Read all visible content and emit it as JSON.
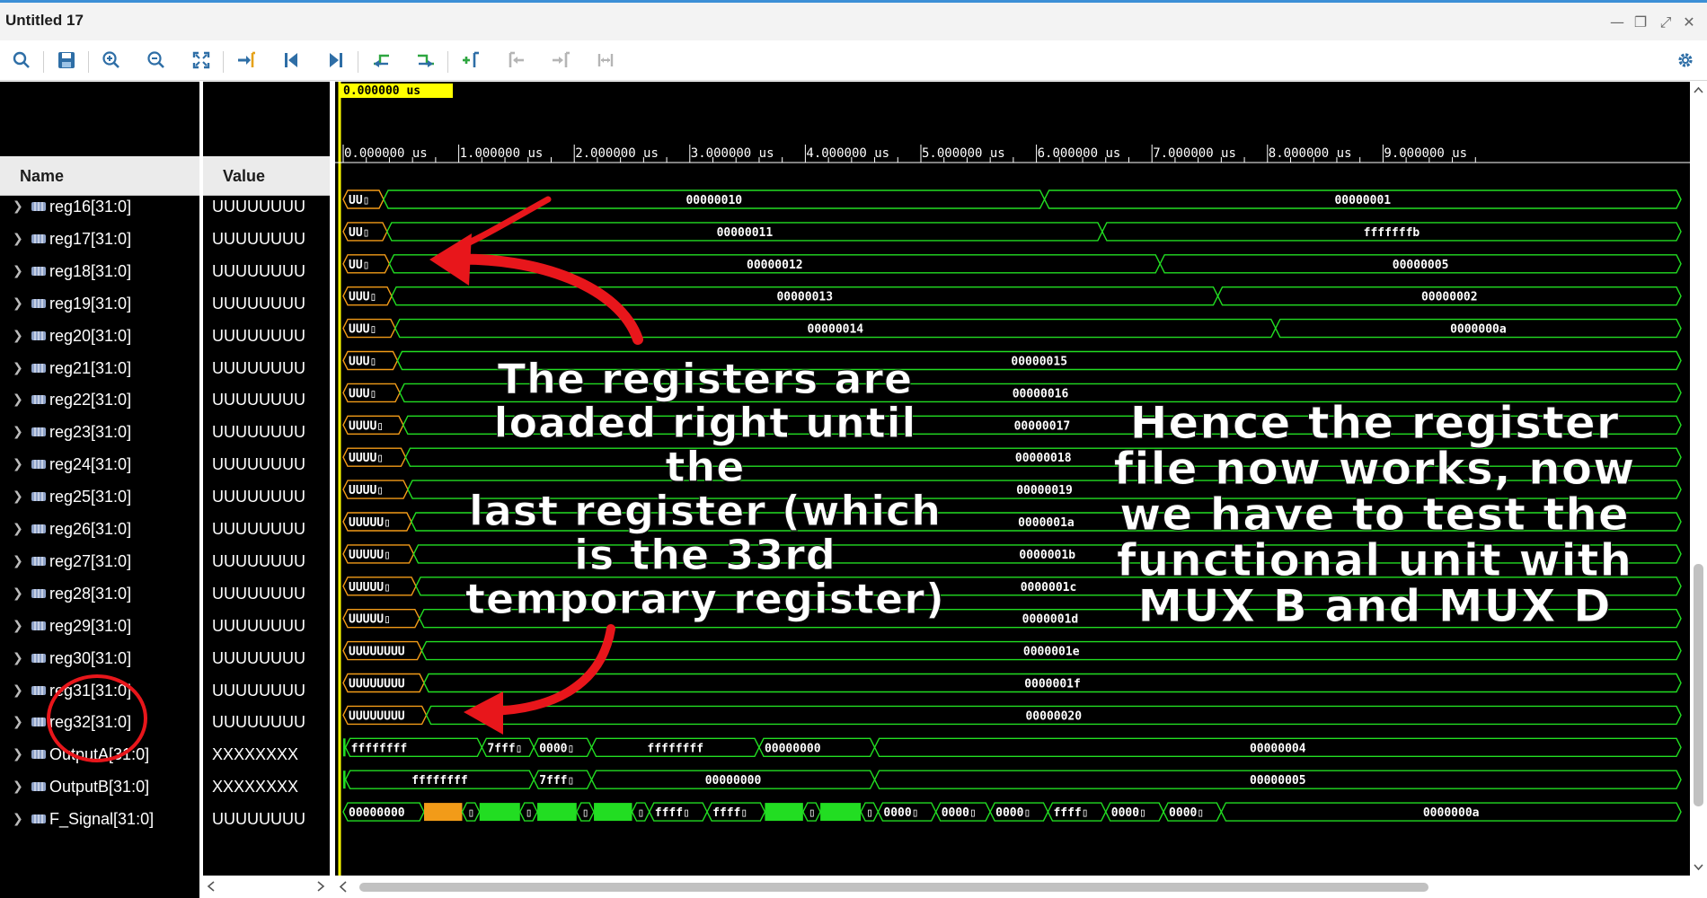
{
  "window": {
    "title": "Untitled 17",
    "controls": [
      "—",
      "❐",
      "⤢",
      "✕"
    ]
  },
  "toolbar": {
    "buttons": [
      {
        "icon": "search-icon",
        "name": "search"
      },
      {
        "icon": "save-icon",
        "name": "save"
      },
      {
        "icon": "zoom-in-icon",
        "name": "zoom-in"
      },
      {
        "icon": "zoom-out-icon",
        "name": "zoom-out"
      },
      {
        "icon": "zoom-fit-icon",
        "name": "zoom-fit"
      },
      {
        "icon": "go-to-cursor-icon",
        "name": "go-to-cursor"
      },
      {
        "icon": "go-to-time-0-icon",
        "name": "go-to-time-0"
      },
      {
        "icon": "go-to-last-time-icon",
        "name": "go-to-last-time"
      },
      {
        "icon": "previous-transition-icon",
        "name": "previous-transition"
      },
      {
        "icon": "next-transition-icon",
        "name": "next-transition"
      },
      {
        "icon": "add-marker-icon",
        "name": "add-marker"
      },
      {
        "icon": "previous-marker-icon",
        "name": "previous-marker"
      },
      {
        "icon": "next-marker-icon",
        "name": "next-marker"
      },
      {
        "icon": "swap-cursors-icon",
        "name": "swap-cursors"
      }
    ],
    "settings_icon": "gear-icon"
  },
  "columns": {
    "name": "Name",
    "value": "Value"
  },
  "cursor": {
    "time": "0.000000 us"
  },
  "timeline": {
    "ticks": [
      "0.000000 us",
      "1.000000 us",
      "2.000000 us",
      "3.000000 us",
      "4.000000 us",
      "5.000000 us",
      "6.000000 us",
      "7.000000 us",
      "8.000000 us",
      "9.000000 us"
    ]
  },
  "signals": [
    {
      "name": "reg16[31:0]",
      "value": "UUUUUUUU",
      "waves": [
        {
          "t": 0.0,
          "label": "UU▯"
        },
        {
          "t": 0.35,
          "label": "00000010"
        },
        {
          "t": 6.07,
          "label": "00000001"
        }
      ]
    },
    {
      "name": "reg17[31:0]",
      "value": "UUUUUUUU",
      "waves": [
        {
          "t": 0.0,
          "label": "UU▯"
        },
        {
          "t": 0.38,
          "label": "00000011"
        },
        {
          "t": 6.57,
          "label": "fffffffb"
        }
      ]
    },
    {
      "name": "reg18[31:0]",
      "value": "UUUUUUUU",
      "waves": [
        {
          "t": 0.0,
          "label": "UU▯"
        },
        {
          "t": 0.4,
          "label": "00000012"
        },
        {
          "t": 7.07,
          "label": "00000005"
        }
      ]
    },
    {
      "name": "reg19[31:0]",
      "value": "UUUUUUUU",
      "waves": [
        {
          "t": 0.0,
          "label": "UUU▯"
        },
        {
          "t": 0.42,
          "label": "00000013"
        },
        {
          "t": 7.57,
          "label": "00000002"
        }
      ]
    },
    {
      "name": "reg20[31:0]",
      "value": "UUUUUUUU",
      "waves": [
        {
          "t": 0.0,
          "label": "UUU▯"
        },
        {
          "t": 0.45,
          "label": "00000014"
        },
        {
          "t": 8.07,
          "label": "0000000a"
        }
      ]
    },
    {
      "name": "reg21[31:0]",
      "value": "UUUUUUUU",
      "waves": [
        {
          "t": 0.0,
          "label": "UUU▯"
        },
        {
          "t": 0.47,
          "label": "00000015"
        }
      ]
    },
    {
      "name": "reg22[31:0]",
      "value": "UUUUUUUU",
      "waves": [
        {
          "t": 0.0,
          "label": "UUU▯"
        },
        {
          "t": 0.49,
          "label": "00000016"
        }
      ]
    },
    {
      "name": "reg23[31:0]",
      "value": "UUUUUUUU",
      "waves": [
        {
          "t": 0.0,
          "label": "UUUU▯"
        },
        {
          "t": 0.52,
          "label": "00000017"
        }
      ]
    },
    {
      "name": "reg24[31:0]",
      "value": "UUUUUUUU",
      "waves": [
        {
          "t": 0.0,
          "label": "UUUU▯"
        },
        {
          "t": 0.54,
          "label": "00000018"
        }
      ]
    },
    {
      "name": "reg25[31:0]",
      "value": "UUUUUUUU",
      "waves": [
        {
          "t": 0.0,
          "label": "UUUU▯"
        },
        {
          "t": 0.56,
          "label": "00000019"
        }
      ]
    },
    {
      "name": "reg26[31:0]",
      "value": "UUUUUUUU",
      "waves": [
        {
          "t": 0.0,
          "label": "UUUUU▯"
        },
        {
          "t": 0.59,
          "label": "0000001a"
        }
      ]
    },
    {
      "name": "reg27[31:0]",
      "value": "UUUUUUUU",
      "waves": [
        {
          "t": 0.0,
          "label": "UUUUU▯"
        },
        {
          "t": 0.61,
          "label": "0000001b"
        }
      ]
    },
    {
      "name": "reg28[31:0]",
      "value": "UUUUUUUU",
      "waves": [
        {
          "t": 0.0,
          "label": "UUUUU▯"
        },
        {
          "t": 0.63,
          "label": "0000001c"
        }
      ]
    },
    {
      "name": "reg29[31:0]",
      "value": "UUUUUUUU",
      "waves": [
        {
          "t": 0.0,
          "label": "UUUUU▯"
        },
        {
          "t": 0.66,
          "label": "0000001d"
        }
      ]
    },
    {
      "name": "reg30[31:0]",
      "value": "UUUUUUUU",
      "waves": [
        {
          "t": 0.0,
          "label": "UUUUUUUU"
        },
        {
          "t": 0.68,
          "label": "0000001e"
        }
      ]
    },
    {
      "name": "reg31[31:0]",
      "value": "UUUUUUUU",
      "waves": [
        {
          "t": 0.0,
          "label": "UUUUUUUU"
        },
        {
          "t": 0.7,
          "label": "0000001f"
        }
      ]
    },
    {
      "name": "reg32[31:0]",
      "value": "UUUUUUUU",
      "waves": [
        {
          "t": 0.0,
          "label": "UUUUUUUU"
        },
        {
          "t": 0.72,
          "label": "00000020"
        }
      ]
    },
    {
      "name": "OutputA[31:0]",
      "value": "XXXXXXXX",
      "waves": [
        {
          "t": 0.0,
          "label": "",
          "fill": "#22dd22",
          "end": 0.02
        },
        {
          "t": 0.02,
          "label": "ffffffff"
        },
        {
          "t": 1.2,
          "label": "7fff▯"
        },
        {
          "t": 1.65,
          "label": "0000▯"
        },
        {
          "t": 2.15,
          "label": "ffffffff"
        },
        {
          "t": 3.6,
          "label": "00000000"
        },
        {
          "t": 4.6,
          "label": "00000004"
        }
      ]
    },
    {
      "name": "OutputB[31:0]",
      "value": "XXXXXXXX",
      "waves": [
        {
          "t": 0.0,
          "label": "",
          "fill": "#22dd22",
          "end": 0.02
        },
        {
          "t": 0.02,
          "label": "ffffffff"
        },
        {
          "t": 1.65,
          "label": "7fff▯"
        },
        {
          "t": 2.15,
          "label": "00000000"
        },
        {
          "t": 4.6,
          "label": "00000005"
        }
      ]
    },
    {
      "name": "F_Signal[31:0]",
      "value": "UUUUUUUU",
      "waves": [
        {
          "t": 0.0,
          "label": "00000000"
        },
        {
          "t": 0.7,
          "label": "",
          "fill": "#f29b18",
          "end": 1.03
        },
        {
          "t": 1.03,
          "label": "▯"
        },
        {
          "t": 1.18,
          "label": "",
          "fill": "#22dd22",
          "end": 1.53
        },
        {
          "t": 1.53,
          "label": "▯"
        },
        {
          "t": 1.68,
          "label": "",
          "fill": "#22dd22",
          "end": 2.02
        },
        {
          "t": 2.02,
          "label": "▯"
        },
        {
          "t": 2.17,
          "label": "",
          "fill": "#22dd22",
          "end": 2.5
        },
        {
          "t": 2.5,
          "label": "▯"
        },
        {
          "t": 2.65,
          "label": "ffff▯"
        },
        {
          "t": 3.15,
          "label": "ffff▯"
        },
        {
          "t": 3.65,
          "label": "",
          "fill": "#22dd22",
          "end": 3.98
        },
        {
          "t": 3.98,
          "label": "▯"
        },
        {
          "t": 4.13,
          "label": "",
          "fill": "#22dd22",
          "end": 4.48
        },
        {
          "t": 4.48,
          "label": "▯"
        },
        {
          "t": 4.63,
          "label": "0000▯"
        },
        {
          "t": 5.13,
          "label": "0000▯"
        },
        {
          "t": 5.6,
          "label": "0000▯"
        },
        {
          "t": 6.1,
          "label": "ffff▯"
        },
        {
          "t": 6.6,
          "label": "0000▯"
        },
        {
          "t": 7.1,
          "label": "0000▯"
        },
        {
          "t": 7.6,
          "label": "0000000a"
        }
      ]
    }
  ],
  "annotations": {
    "left": [
      "The registers are",
      "loaded right until the",
      "last register (which",
      "is the 33rd",
      "temporary register)"
    ],
    "right": [
      "Hence the register",
      "file now works, now",
      "we have to test the",
      "functional unit with",
      "MUX B and MUX D"
    ]
  },
  "colors": {
    "wave": "#22dd22",
    "undefined": "#f29b18",
    "cursor": "#ffff00",
    "annotation_arrow": "#e8161b"
  }
}
